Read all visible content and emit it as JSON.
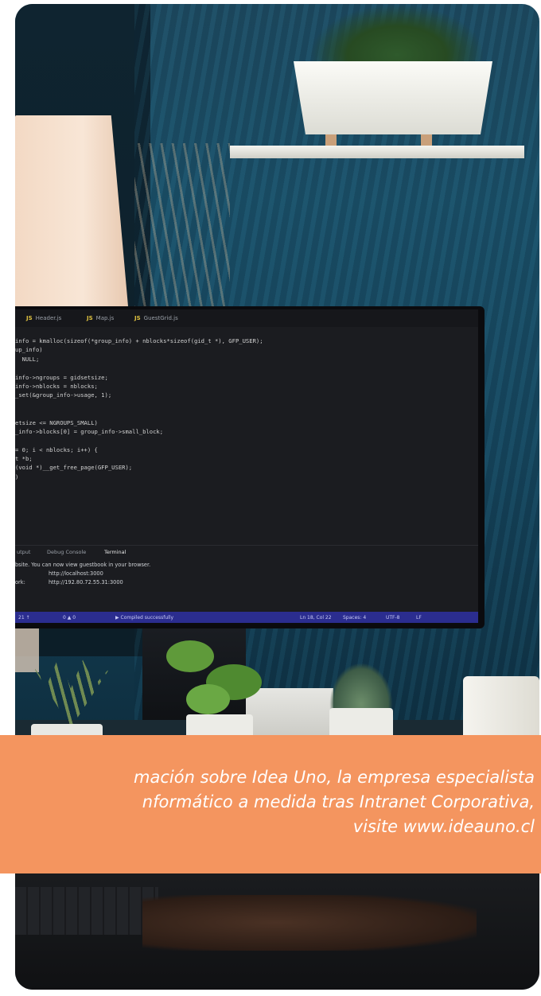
{
  "editor": {
    "tabs": [
      "Header.js",
      "Map.js",
      "GuestGrid.js"
    ],
    "js_badge": "JS",
    "code_lines": [
      "info = kmalloc(sizeof(*group_info) + nblocks*sizeof(gid_t *), GFP_USER);",
      "up_info)",
      "  NULL;",
      "",
      "info->ngroups = gidsetsize;",
      "info->nblocks = nblocks;",
      "_set(&group_info->usage, 1);",
      "",
      "",
      "etsize <= NGROUPS_SMALL)",
      "_info->blocks[0] = group_info->small_block;",
      "",
      "= 0; i < nblocks; i++) {",
      "t *b;",
      "(void *)__get_free_page(GFP_USER);",
      ")",
      ""
    ],
    "panel_tabs": [
      "utput",
      "Debug Console",
      "Terminal"
    ],
    "terminal_lines": [
      {
        "label": "",
        "text": "bsite. You can now view guestbook in your browser."
      },
      {
        "label": "",
        "text": "http://localhost:3000"
      },
      {
        "label": "ork:",
        "text": "http://192.80.72.55.31:3000"
      }
    ],
    "status_items": [
      "21 ↑",
      "0 ▲ 0",
      "▶ Compiled successfully",
      "Ln 18, Col 22",
      "Spaces: 4",
      "UTF-8",
      "LF"
    ]
  },
  "banner": {
    "line1": "mación sobre Idea Uno, la empresa especialista",
    "line2": "nformático a medida tras Intranet Corporativa,",
    "line3": "visite www.ideauno.cl",
    "color": "#f4955f"
  }
}
